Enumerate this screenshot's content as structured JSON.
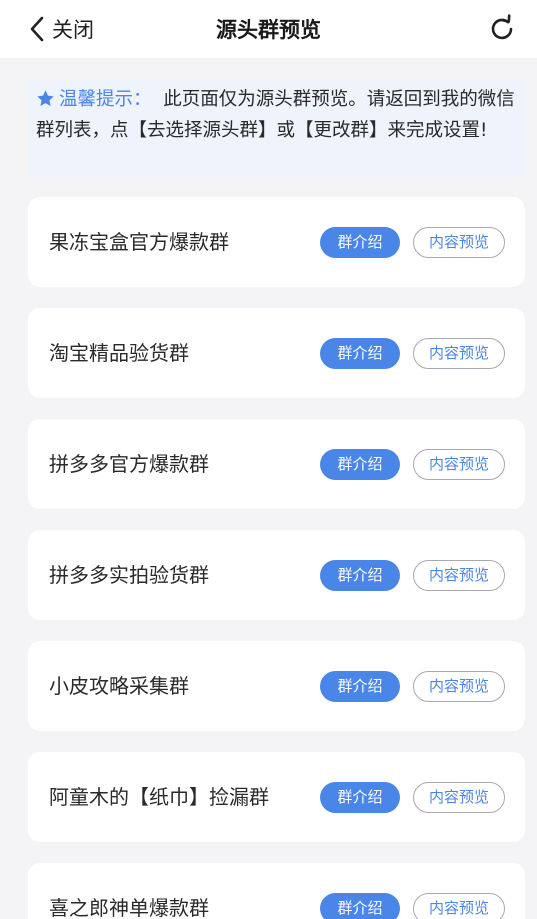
{
  "header": {
    "back_label": "关闭",
    "title": "源头群预览"
  },
  "notice": {
    "prefix": "温馨提示：",
    "text": "此页面仅为源头群预览。请返回到我的微信群列表，点【去选择源头群】或【更改群】来完成设置!"
  },
  "buttons": {
    "intro_label": "群介绍",
    "preview_label": "内容预览"
  },
  "groups": [
    {
      "name": "果冻宝盒官方爆款群"
    },
    {
      "name": "淘宝精品验货群"
    },
    {
      "name": "拼多多官方爆款群"
    },
    {
      "name": "拼多多实拍验货群"
    },
    {
      "name": "小皮攻略采集群"
    },
    {
      "name": "阿童木的【纸巾】捡漏群"
    },
    {
      "name": "喜之郎神单爆款群"
    }
  ],
  "colors": {
    "accent": "#4a86e8",
    "notice_bg": "#eef3fc",
    "page_bg": "#f4f4f6"
  }
}
